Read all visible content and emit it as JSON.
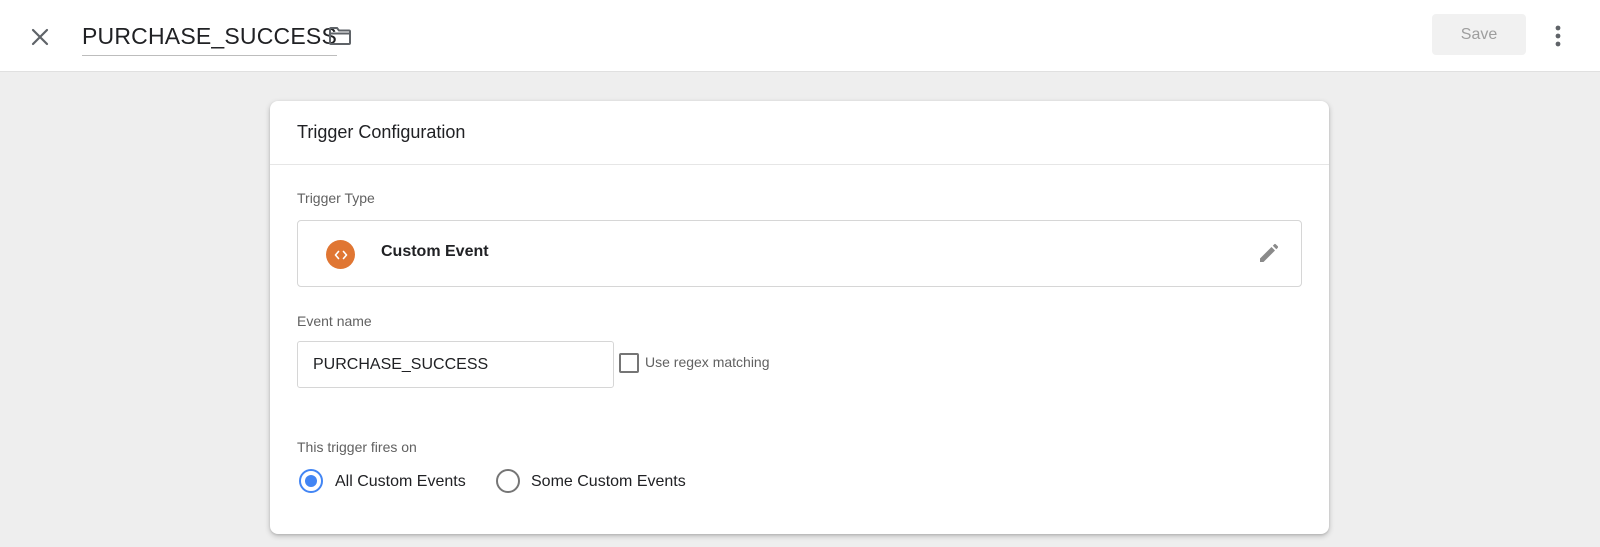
{
  "header": {
    "title": "PURCHASE_SUCCESS",
    "save_label": "Save",
    "icons": {
      "close": "close-icon",
      "folder": "folder-icon",
      "more": "more-vert-icon"
    }
  },
  "card": {
    "title": "Trigger Configuration",
    "trigger_type": {
      "label": "Trigger Type",
      "value": "Custom Event",
      "icon": "code-icon",
      "icon_color": "#e07633",
      "edit_icon": "pencil-icon"
    },
    "event_name": {
      "label": "Event name",
      "value": "PURCHASE_SUCCESS"
    },
    "regex": {
      "label": "Use regex matching",
      "checked": false
    },
    "fires_on": {
      "label": "This trigger fires on",
      "options": [
        {
          "label": "All Custom Events",
          "selected": true
        },
        {
          "label": "Some Custom Events",
          "selected": false
        }
      ]
    }
  },
  "colors": {
    "accent": "#4285f4",
    "custom_event_icon": "#e07633"
  }
}
